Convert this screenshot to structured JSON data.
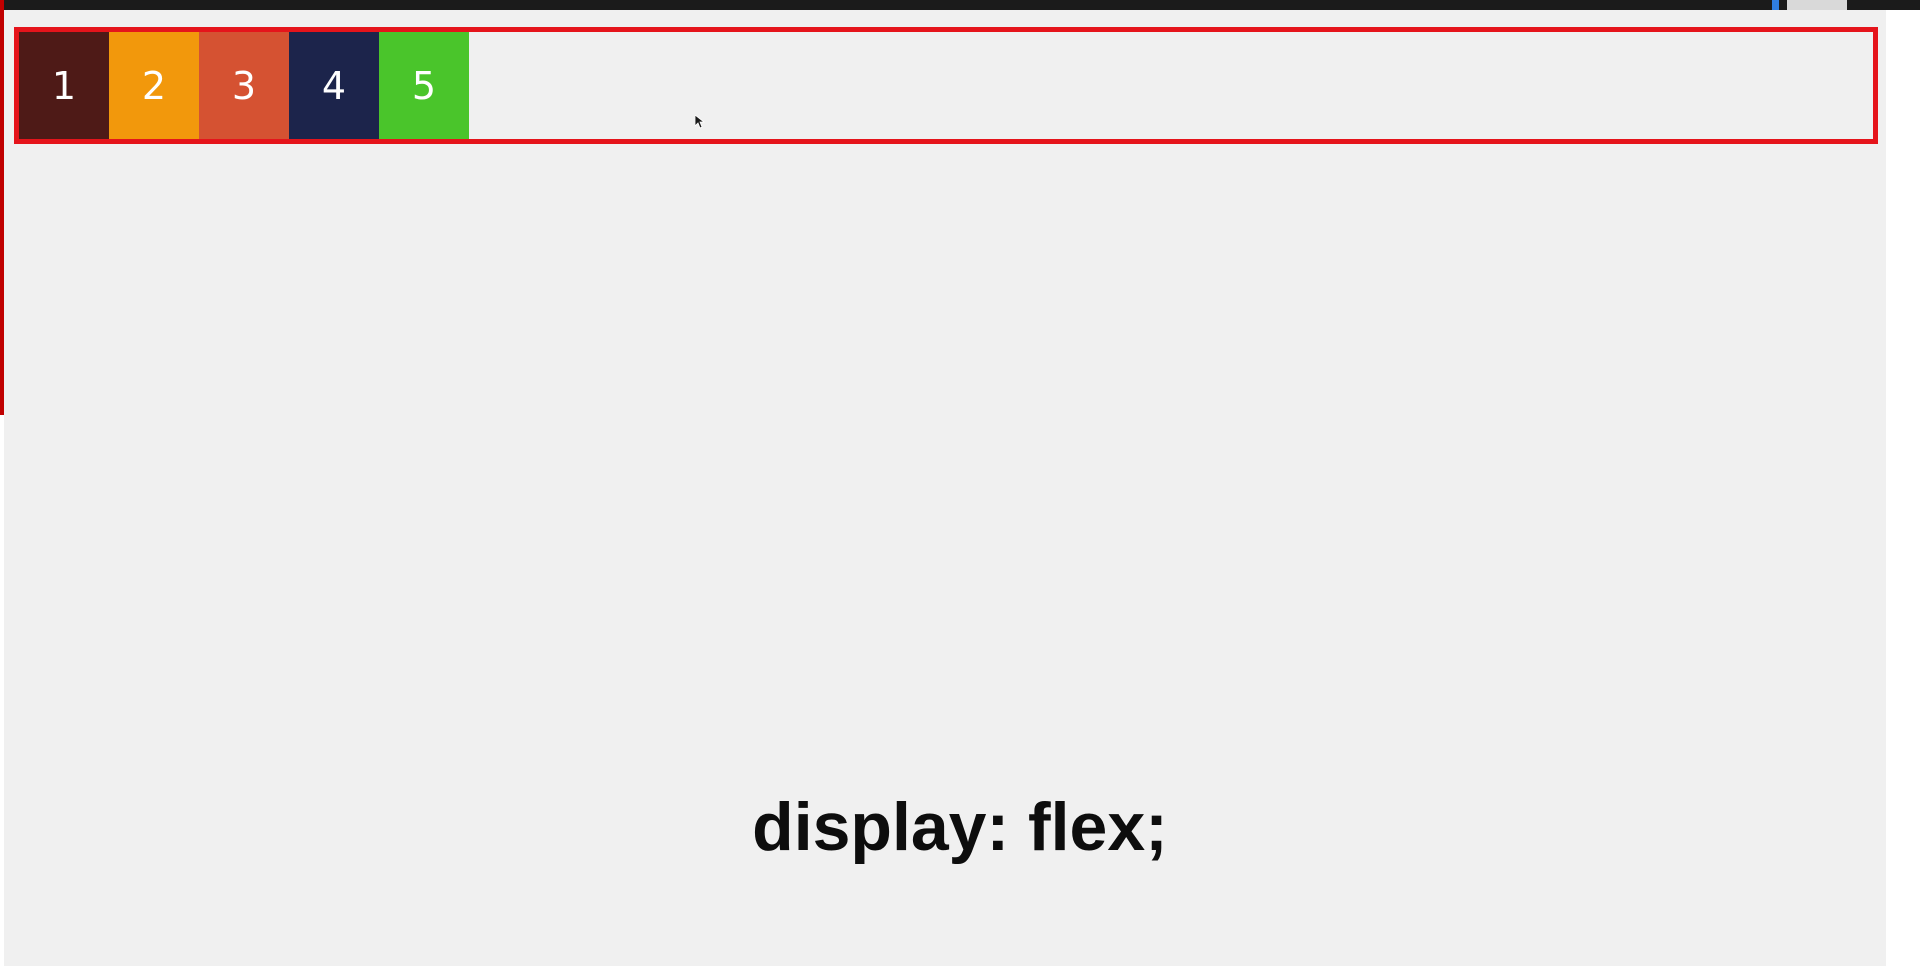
{
  "flex_demo": {
    "items": [
      {
        "label": "1",
        "color": "#4e1a17"
      },
      {
        "label": "2",
        "color": "#f2980c"
      },
      {
        "label": "3",
        "color": "#d55232"
      },
      {
        "label": "4",
        "color": "#1c244b"
      },
      {
        "label": "5",
        "color": "#4ac52b"
      }
    ],
    "border_color": "#e5141b",
    "background_color": "#f0f0f0"
  },
  "caption": "display: flex;"
}
